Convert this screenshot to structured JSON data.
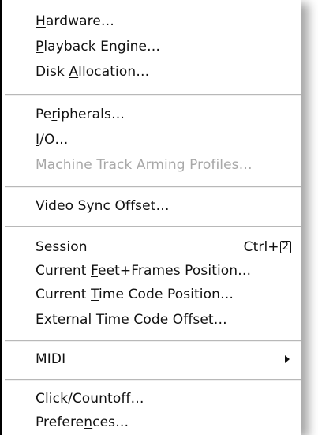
{
  "menu": {
    "items": [
      {
        "pre": "",
        "ul": "H",
        "post": "ardware…"
      },
      {
        "pre": "",
        "ul": "P",
        "post": "layback Engine…"
      },
      {
        "pre": "Disk ",
        "ul": "A",
        "post": "llocation…"
      },
      {
        "pre": "Pe",
        "ul": "r",
        "post": "ipherals…"
      },
      {
        "pre": "",
        "ul": "I",
        "post": "/O…"
      },
      {
        "label": "Machine Track Arming Profiles…",
        "disabled": true
      },
      {
        "pre": "Video Sync ",
        "ul": "O",
        "post": "ffset…"
      },
      {
        "pre": "",
        "ul": "S",
        "post": "ession",
        "shortcut_mod": "Ctrl+",
        "shortcut_key": "2"
      },
      {
        "pre": "Current ",
        "ul": "F",
        "post": "eet+Frames Position…"
      },
      {
        "pre": "Current ",
        "ul": "T",
        "post": "ime Code Position…"
      },
      {
        "label": "External Time Code Offset…"
      },
      {
        "label": "MIDI",
        "submenu": true
      },
      {
        "label": "Click/Countoff…"
      },
      {
        "pre": "Prefere",
        "ul": "n",
        "post": "ces…"
      }
    ]
  },
  "colors": {
    "text": "#111111",
    "disabled": "#a8a8a8",
    "separator": "#b8b8b8"
  }
}
